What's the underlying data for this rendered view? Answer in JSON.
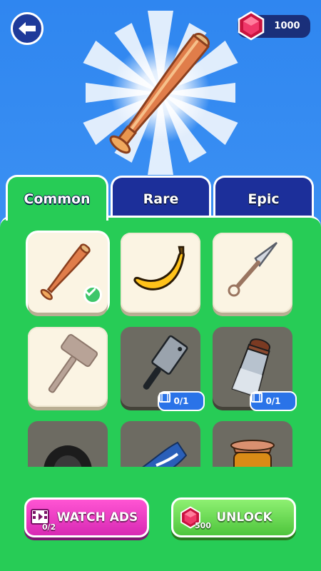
{
  "header": {
    "gem_count": "1000"
  },
  "tabs": [
    {
      "label": "Common",
      "active": true
    },
    {
      "label": "Rare",
      "active": false
    },
    {
      "label": "Epic",
      "active": false
    }
  ],
  "items": [
    {
      "name": "baseball bat",
      "icon": "bat-icon",
      "state": "selected"
    },
    {
      "name": "banana",
      "icon": "banana-icon",
      "state": "unlocked"
    },
    {
      "name": "kunai",
      "icon": "kunai-icon",
      "state": "unlocked"
    },
    {
      "name": "mallet",
      "icon": "mallet-icon",
      "state": "unlocked"
    },
    {
      "name": "cleaver",
      "icon": "cleaver-icon",
      "state": "locked",
      "progress": "0/1"
    },
    {
      "name": "salt shaker",
      "icon": "salt-shaker-icon",
      "state": "locked",
      "progress": "0/1"
    },
    {
      "name": "tire",
      "icon": "tire-icon",
      "state": "locked"
    },
    {
      "name": "sneaker",
      "icon": "sneaker-icon",
      "state": "locked"
    },
    {
      "name": "honey jar",
      "icon": "honey-jar-icon",
      "state": "locked"
    }
  ],
  "buttons": {
    "watch_ads_label": "WATCH ADS",
    "watch_ads_count": "0/2",
    "unlock_label": "UNLOCK",
    "unlock_cost": "500"
  },
  "colors": {
    "panel_green": "#27cc56",
    "tab_navy": "#1c2f9a",
    "watch_pink": "#e639c0",
    "unlock_green": "#6bdc55",
    "gem_red": "#e8285a"
  }
}
